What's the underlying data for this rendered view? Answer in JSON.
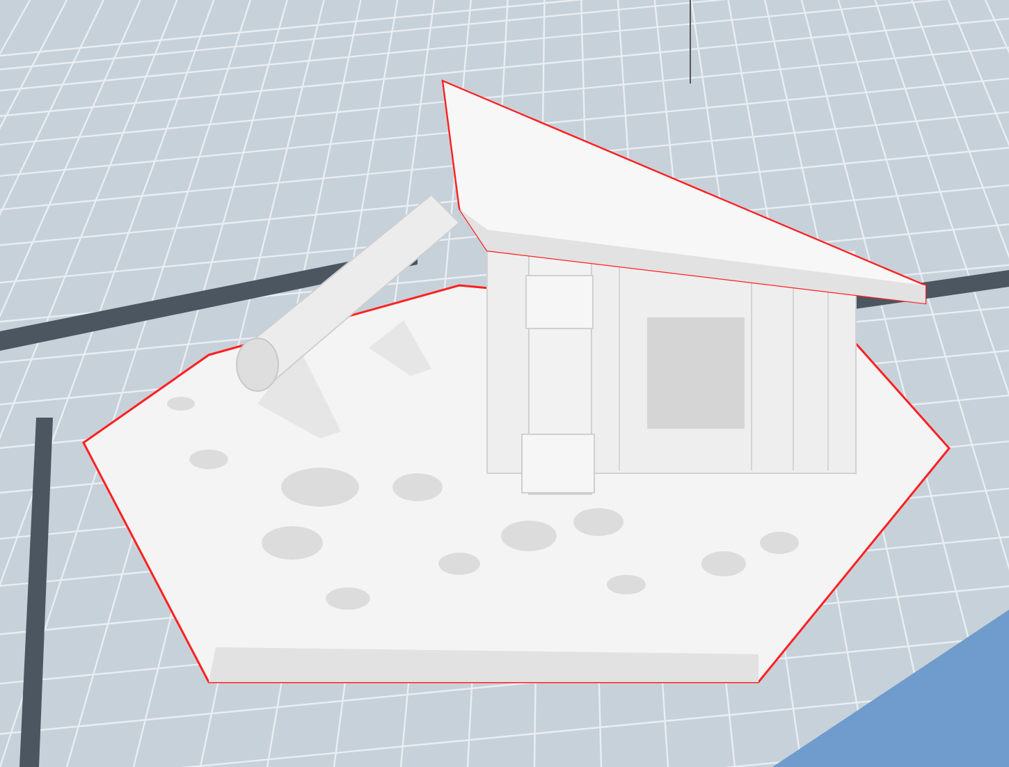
{
  "viewport": {
    "kind": "build-plate",
    "model_selected": true
  }
}
